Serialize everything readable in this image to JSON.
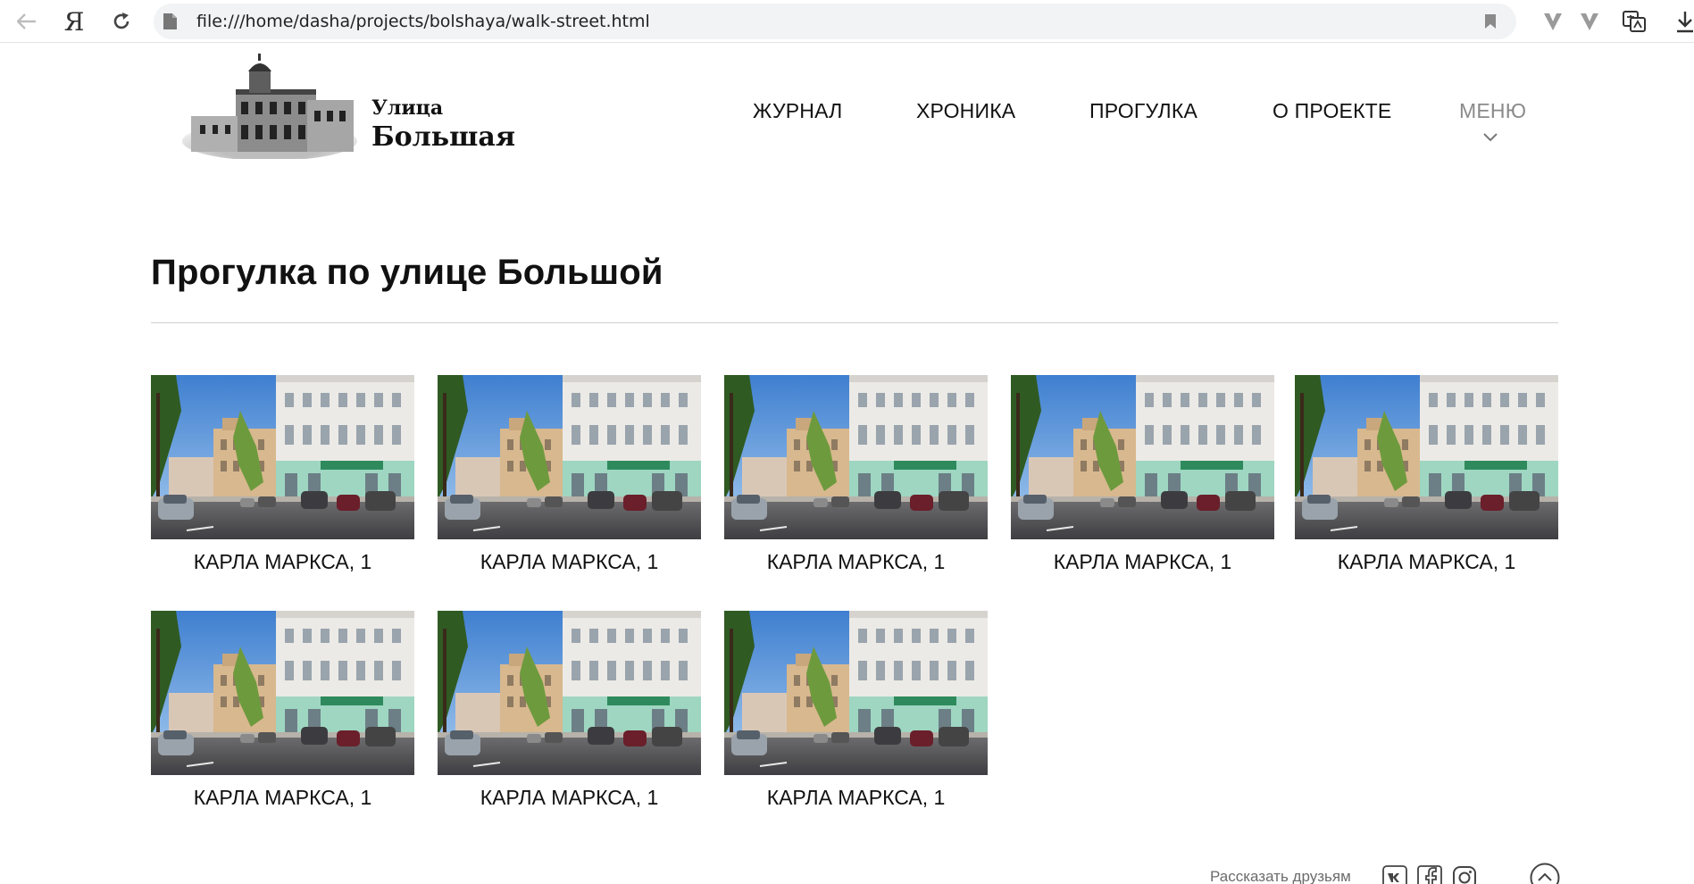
{
  "browser": {
    "url": "file:///home/dasha/projects/bolshaya/walk-street.html",
    "yandex_logo": "Я"
  },
  "site": {
    "logo_line1": "Улица",
    "logo_line2": "Большая",
    "nav": {
      "journal": "ЖУРНАЛ",
      "chronicle": "ХРОНИКА",
      "walk": "ПРОГУЛКА",
      "about": "О ПРОЕКТЕ",
      "menu": "МЕНЮ"
    }
  },
  "page": {
    "title": "Прогулка по улице Большой"
  },
  "cards": [
    {
      "caption": "КАРЛА МАРКСА, 1"
    },
    {
      "caption": "КАРЛА МАРКСА, 1"
    },
    {
      "caption": "КАРЛА МАРКСА, 1"
    },
    {
      "caption": "КАРЛА МАРКСА, 1"
    },
    {
      "caption": "КАРЛА МАРКСА, 1"
    },
    {
      "caption": "КАРЛА МАРКСА, 1"
    },
    {
      "caption": "КАРЛА МАРКСА, 1"
    },
    {
      "caption": "КАРЛА МАРКСА, 1"
    }
  ],
  "footer": {
    "share_label": "Рассказать друзьям",
    "socials": [
      "vk-icon",
      "facebook-icon",
      "instagram-icon"
    ]
  },
  "colors": {
    "text": "#111111",
    "muted": "#8a8a8a",
    "rule": "#cfcfcf",
    "addressbar": "#f1f3f4"
  }
}
